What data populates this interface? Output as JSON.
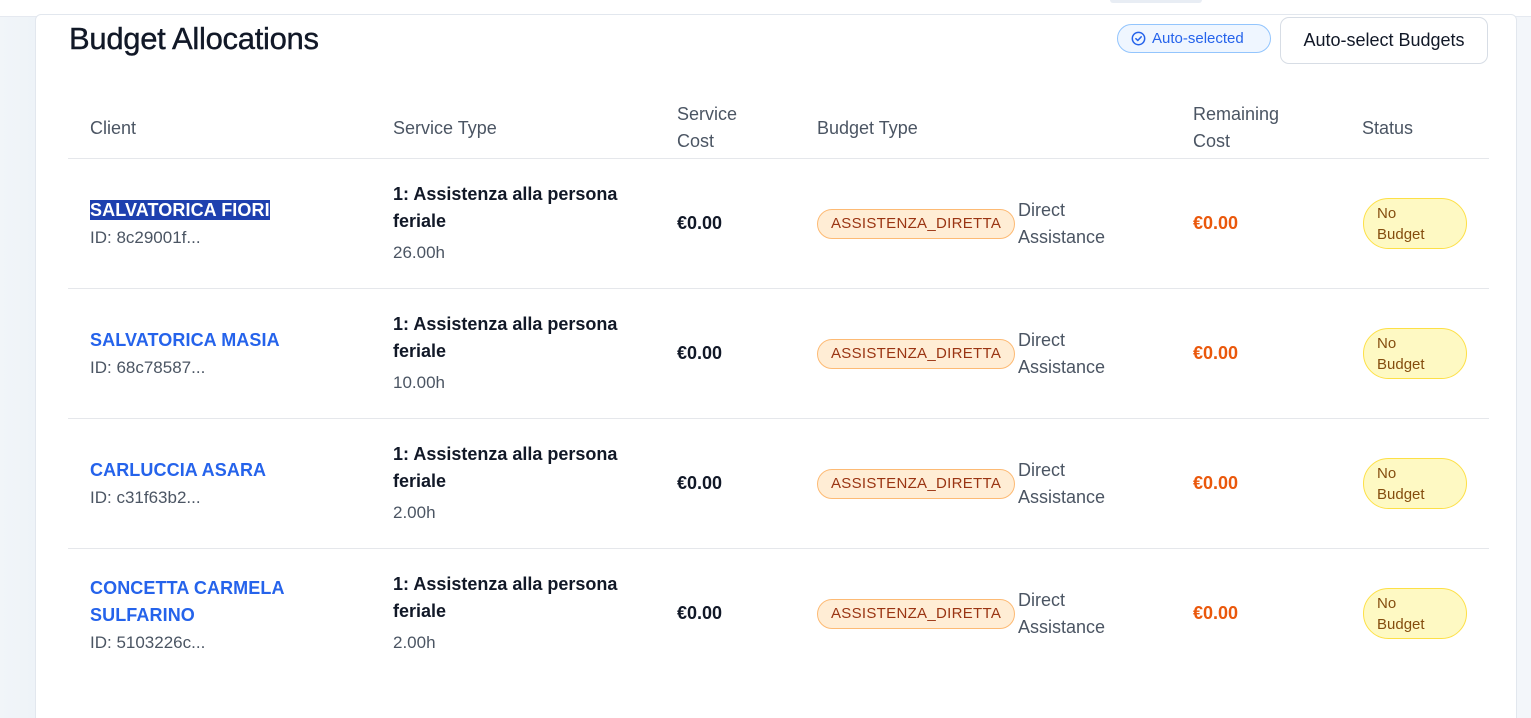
{
  "header": {
    "title": "Budget Allocations",
    "auto_selected_badge": "Auto-selected",
    "auto_select_button": "Auto-select Budgets"
  },
  "table": {
    "columns": [
      "Client",
      "Service Type",
      "Service Cost",
      "Budget Type",
      "Remaining Cost",
      "Status"
    ],
    "columns_display": {
      "client": "Client",
      "service_type": "Service Type",
      "service_cost_line1": "Service",
      "service_cost_line2": "Cost",
      "budget_type": "Budget Type",
      "remaining_cost_line1": "Remaining",
      "remaining_cost_line2": "Cost",
      "status": "Status"
    },
    "rows": [
      {
        "client_name": "SALVATORICA FIORI",
        "client_id": "ID: 8c29001f...",
        "service_line1": "1: Assistenza alla persona",
        "service_line2": "feriale",
        "hours": "26.00h",
        "service_cost": "€0.00",
        "budget_code": "ASSISTENZA_DIRETTA",
        "budget_desc_line1": "Direct",
        "budget_desc_line2": "Assistance",
        "remaining_cost": "€0.00",
        "status_line1": "No",
        "status_line2": "Budget",
        "selected": true
      },
      {
        "client_name": "SALVATORICA MASIA",
        "client_id": "ID: 68c78587...",
        "service_line1": "1: Assistenza alla persona",
        "service_line2": "feriale",
        "hours": "10.00h",
        "service_cost": "€0.00",
        "budget_code": "ASSISTENZA_DIRETTA",
        "budget_desc_line1": "Direct",
        "budget_desc_line2": "Assistance",
        "remaining_cost": "€0.00",
        "status_line1": "No",
        "status_line2": "Budget"
      },
      {
        "client_name": "CARLUCCIA ASARA",
        "client_id": "ID: c31f63b2...",
        "service_line1": "1: Assistenza alla persona",
        "service_line2": "feriale",
        "hours": "2.00h",
        "service_cost": "€0.00",
        "budget_code": "ASSISTENZA_DIRETTA",
        "budget_desc_line1": "Direct",
        "budget_desc_line2": "Assistance",
        "remaining_cost": "€0.00",
        "status_line1": "No",
        "status_line2": "Budget"
      },
      {
        "client_name_line1": "CONCETTA CARMELA",
        "client_name_line2": "SULFARINO",
        "client_id": "ID: 5103226c...",
        "service_line1": "1: Assistenza alla persona",
        "service_line2": "feriale",
        "hours": "2.00h",
        "service_cost": "€0.00",
        "budget_code": "ASSISTENZA_DIRETTA",
        "budget_desc_line1": "Direct",
        "budget_desc_line2": "Assistance",
        "remaining_cost": "€0.00",
        "status_line1": "No",
        "status_line2": "Budget"
      }
    ]
  },
  "colors": {
    "link": "#2563eb",
    "remaining": "#ea580c",
    "budget_badge_bg": "#ffedd5",
    "status_badge_bg": "#fef9c3"
  },
  "icons": {
    "auto_selected": "check-circle-icon"
  }
}
